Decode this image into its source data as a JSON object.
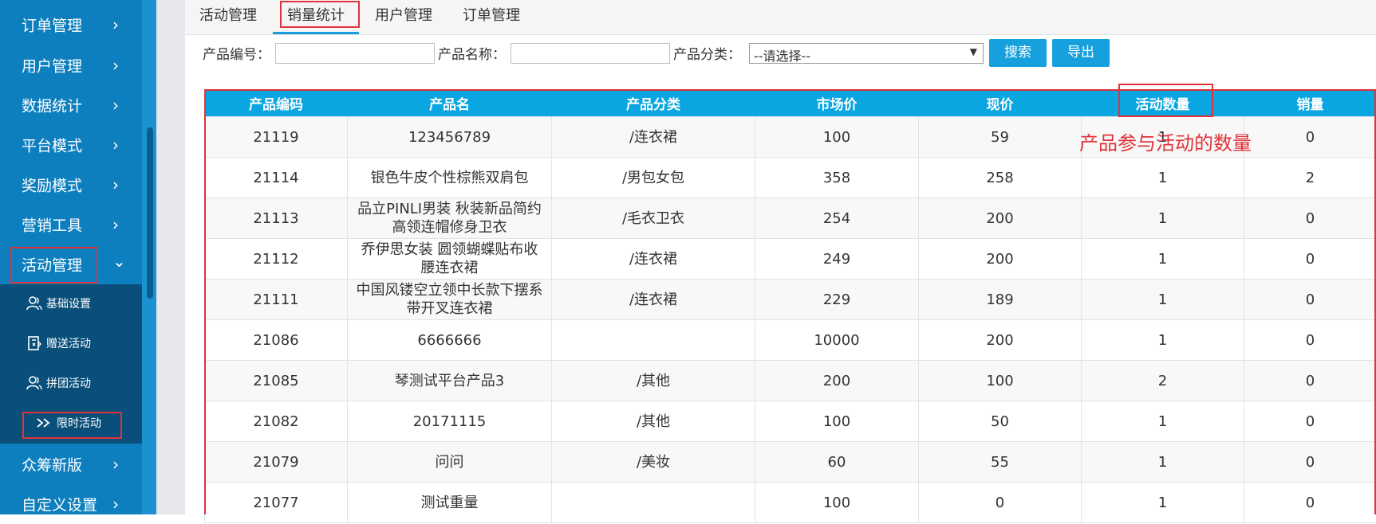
{
  "sidebar": {
    "items": [
      {
        "label": "订单管理",
        "expanded": false
      },
      {
        "label": "用户管理",
        "expanded": false
      },
      {
        "label": "数据统计",
        "expanded": false
      },
      {
        "label": "平台模式",
        "expanded": false
      },
      {
        "label": "奖励模式",
        "expanded": false
      },
      {
        "label": "营销工具",
        "expanded": false
      },
      {
        "label": "活动管理",
        "expanded": true
      },
      {
        "label": "众筹新版",
        "expanded": false
      },
      {
        "label": "自定义设置",
        "expanded": false
      }
    ],
    "sub_items": [
      {
        "label": "基础设置",
        "icon": "users-icon"
      },
      {
        "label": "赠送活动",
        "icon": "gift-icon"
      },
      {
        "label": "拼团活动",
        "icon": "users-icon"
      },
      {
        "label": "限时活动",
        "icon": "double-chevron-right-icon"
      }
    ],
    "chevron_right": "›",
    "chevron_down": "⌄"
  },
  "tabs": [
    "活动管理",
    "销量统计",
    "用户管理",
    "订单管理"
  ],
  "active_tab": "销量统计",
  "filter": {
    "code_label": "产品编号：",
    "name_label": "产品名称：",
    "category_label": "产品分类：",
    "category_value": "--请选择--",
    "search_button": "搜索",
    "export_button": "导出"
  },
  "table": {
    "headers": [
      "产品编码",
      "产品名",
      "产品分类",
      "市场价",
      "现价",
      "活动数量",
      "销量"
    ],
    "rows": [
      [
        "21119",
        "123456789",
        "/连衣裙",
        "100",
        "59",
        "1",
        "0"
      ],
      [
        "21114",
        "银色牛皮个性棕熊双肩包",
        "/男包女包",
        "358",
        "258",
        "1",
        "2"
      ],
      [
        "21113",
        "品立PINLI男装 秋装新品简约高领连帽修身卫衣",
        "/毛衣卫衣",
        "254",
        "200",
        "1",
        "0"
      ],
      [
        "21112",
        "乔伊思女装 圆领蝴蝶贴布收腰连衣裙",
        "/连衣裙",
        "249",
        "200",
        "1",
        "0"
      ],
      [
        "21111",
        "中国风镂空立领中长款下摆系带开叉连衣裙",
        "/连衣裙",
        "229",
        "189",
        "1",
        "0"
      ],
      [
        "21086",
        "6666666",
        "",
        "10000",
        "200",
        "1",
        "0"
      ],
      [
        "21085",
        "琴测试平台产品3",
        "/其他",
        "200",
        "100",
        "2",
        "0"
      ],
      [
        "21082",
        "20171115",
        "/其他",
        "100",
        "50",
        "1",
        "0"
      ],
      [
        "21079",
        "问问",
        "/美妆",
        "60",
        "55",
        "1",
        "0"
      ],
      [
        "21077",
        "测试重量",
        "",
        "100",
        "0",
        "1",
        "0"
      ]
    ]
  },
  "annotation": "产品参与活动的数量",
  "colors": {
    "accent": "#0aa6e1",
    "sidebar": "#0d7fbf",
    "highlight": "#e0333a"
  }
}
